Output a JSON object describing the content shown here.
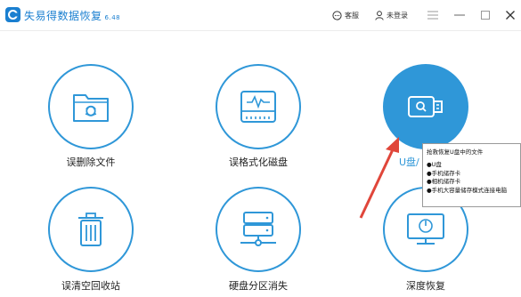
{
  "app": {
    "title": "失易得数据恢复",
    "version": "6.48"
  },
  "toolbar": {
    "feedback_label": "客服",
    "login_label": "未登录"
  },
  "features": [
    {
      "id": "deleted-files",
      "label": "误删除文件",
      "icon": "folder-recover-icon"
    },
    {
      "id": "formatted-disk",
      "label": "误格式化磁盘",
      "icon": "disk-pulse-icon"
    },
    {
      "id": "usb-drive",
      "label": "U盘/",
      "icon": "usb-drive-icon"
    },
    {
      "id": "recycle-bin",
      "label": "误清空回收站",
      "icon": "trash-can-icon"
    },
    {
      "id": "partition-lost",
      "label": "硬盘分区消失",
      "icon": "hard-drive-network-icon"
    },
    {
      "id": "deep-recovery",
      "label": "深度恢复",
      "icon": "monitor-scan-icon"
    }
  ],
  "tooltip": {
    "title": "抢救恢复U盘中的文件",
    "items": [
      "●U盘",
      "●手机储存卡",
      "●相机储存卡",
      "●手机大容量储存模式连接电脑"
    ]
  },
  "colors": {
    "accent": "#2f97d8",
    "arrow": "#e0463a"
  }
}
